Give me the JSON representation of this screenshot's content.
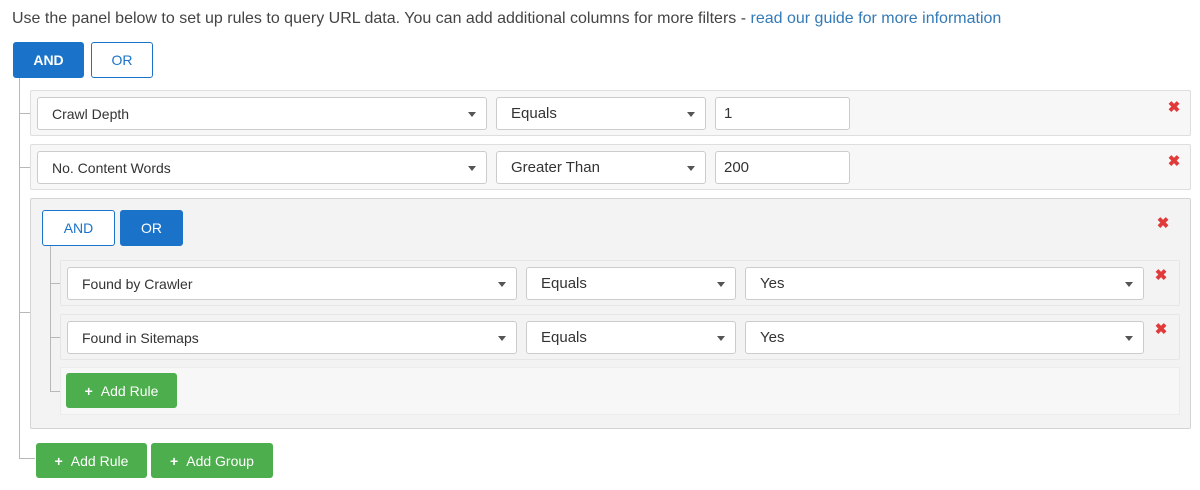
{
  "intro": {
    "text": "Use the panel below to set up rules to query URL data. You can add additional columns for more filters - ",
    "link": "read our guide for more information"
  },
  "root": {
    "and_label": "AND",
    "or_label": "OR",
    "active": "AND",
    "rules": [
      {
        "field": "Crawl Depth",
        "operator": "Equals",
        "value": "1"
      },
      {
        "field": "No. Content Words",
        "operator": "Greater Than",
        "value": "200"
      }
    ],
    "add_rule_label": "Add Rule",
    "add_group_label": "Add Group"
  },
  "group": {
    "and_label": "AND",
    "or_label": "OR",
    "active": "OR",
    "rules": [
      {
        "field": "Found by Crawler",
        "operator": "Equals",
        "value": "Yes"
      },
      {
        "field": "Found in Sitemaps",
        "operator": "Equals",
        "value": "Yes"
      }
    ],
    "add_rule_label": "Add Rule"
  },
  "icons": {
    "delete": "close-icon",
    "add": "plus-icon",
    "dropdown": "chevron-down-icon"
  },
  "colors": {
    "primary": "#1a73c8",
    "success": "#4cae4c",
    "danger": "#e03a3a",
    "link": "#337ab7"
  }
}
